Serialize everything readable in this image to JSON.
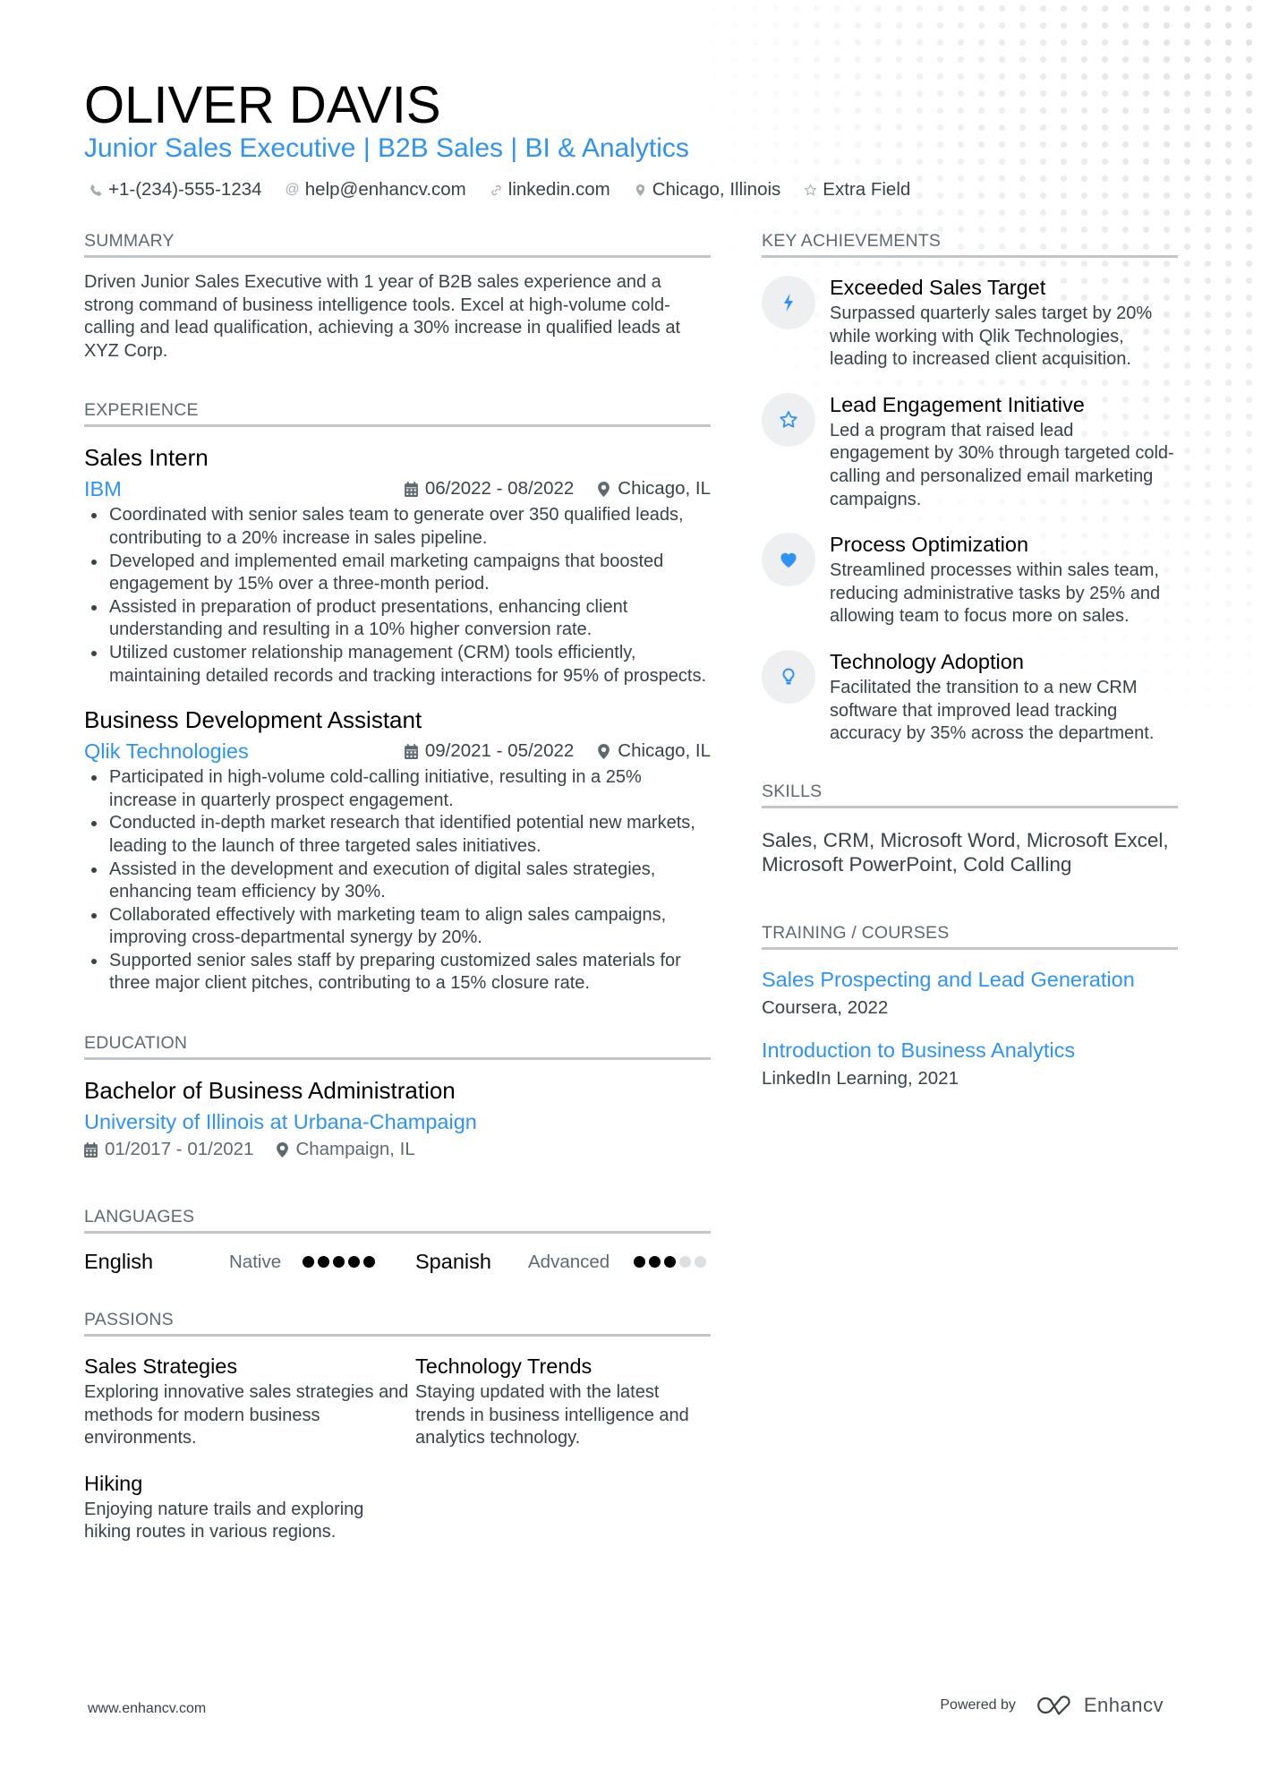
{
  "header": {
    "name": "OLIVER DAVIS",
    "title": "Junior Sales Executive | B2B Sales | BI & Analytics",
    "contacts": [
      {
        "icon": "phone-icon",
        "text": "+1-(234)-555-1234"
      },
      {
        "icon": "at-icon",
        "text": "help@enhancv.com"
      },
      {
        "icon": "link-icon",
        "text": "linkedin.com"
      },
      {
        "icon": "location-icon",
        "text": "Chicago, Illinois"
      },
      {
        "icon": "star-icon",
        "text": "Extra Field"
      }
    ]
  },
  "summary": {
    "heading": "SUMMARY",
    "text": "Driven Junior Sales Executive with 1 year of B2B sales experience and a strong command of business intelligence tools. Excel at high-volume cold-calling and lead qualification, achieving a 30% increase in qualified leads at XYZ Corp."
  },
  "experience": {
    "heading": "EXPERIENCE",
    "jobs": [
      {
        "title": "Sales Intern",
        "company": "IBM",
        "dates": "06/2022 - 08/2022",
        "location": "Chicago, IL",
        "bullets": [
          "Coordinated with senior sales team to generate over 350 qualified leads, contributing to a 20% increase in sales pipeline.",
          "Developed and implemented email marketing campaigns that boosted engagement by 15% over a three-month period.",
          "Assisted in preparation of product presentations, enhancing client understanding and resulting in a 10% higher conversion rate.",
          "Utilized customer relationship management (CRM) tools efficiently, maintaining detailed records and tracking interactions for 95% of prospects."
        ]
      },
      {
        "title": "Business Development Assistant",
        "company": "Qlik Technologies",
        "dates": "09/2021 - 05/2022",
        "location": "Chicago, IL",
        "bullets": [
          "Participated in high-volume cold-calling initiative, resulting in a 25% increase in quarterly prospect engagement.",
          "Conducted in-depth market research that identified potential new markets, leading to the launch of three targeted sales initiatives.",
          "Assisted in the development and execution of digital sales strategies, enhancing team efficiency by 30%.",
          "Collaborated effectively with marketing team to align sales campaigns, improving cross-departmental synergy by 20%.",
          "Supported senior sales staff by preparing customized sales materials for three major client pitches, contributing to a 15% closure rate."
        ]
      }
    ]
  },
  "education": {
    "heading": "EDUCATION",
    "degree": "Bachelor of Business Administration",
    "school": "University of Illinois at Urbana-Champaign",
    "dates": "01/2017 - 01/2021",
    "location": "Champaign, IL"
  },
  "languages": {
    "heading": "LANGUAGES",
    "items": [
      {
        "name": "English",
        "level": "Native",
        "proficiency": 5,
        "max": 5
      },
      {
        "name": "Spanish",
        "level": "Advanced",
        "proficiency": 3,
        "max": 5
      }
    ]
  },
  "passions": {
    "heading": "PASSIONS",
    "items": [
      {
        "title": "Sales Strategies",
        "desc": "Exploring innovative sales strategies and methods for modern business environments."
      },
      {
        "title": "Technology Trends",
        "desc": "Staying updated with the latest trends in business intelligence and analytics technology."
      },
      {
        "title": "Hiking",
        "desc": "Enjoying nature trails and exploring hiking routes in various regions."
      }
    ]
  },
  "achievements": {
    "heading": "KEY ACHIEVEMENTS",
    "items": [
      {
        "icon": "lightning-icon",
        "title": "Exceeded Sales Target",
        "desc": "Surpassed quarterly sales target by 20% while working with Qlik Technologies, leading to increased client acquisition."
      },
      {
        "icon": "star-icon",
        "title": "Lead Engagement Initiative",
        "desc": "Led a program that raised lead engagement by 30% through targeted cold-calling and personalized email marketing campaigns."
      },
      {
        "icon": "heart-icon",
        "title": "Process Optimization",
        "desc": "Streamlined processes within sales team, reducing administrative tasks by 25% and allowing team to focus more on sales."
      },
      {
        "icon": "lightbulb-icon",
        "title": "Technology Adoption",
        "desc": "Facilitated the transition to a new CRM software that improved lead tracking accuracy by 35% across the department."
      }
    ]
  },
  "skills": {
    "heading": "SKILLS",
    "text": "Sales, CRM, Microsoft Word, Microsoft Excel, Microsoft PowerPoint, Cold Calling"
  },
  "training": {
    "heading": "TRAINING / COURSES",
    "items": [
      {
        "title": "Sales Prospecting and Lead Generation",
        "sub": "Coursera, 2022"
      },
      {
        "title": "Introduction to Business Analytics",
        "sub": "LinkedIn Learning, 2021"
      }
    ]
  },
  "footer": {
    "website": "www.enhancv.com",
    "powered_by": "Powered by",
    "brand": "Enhancv"
  },
  "colors": {
    "accent": "#2e93f6",
    "text": "#384347",
    "heading_rule": "#c3c6c8"
  }
}
